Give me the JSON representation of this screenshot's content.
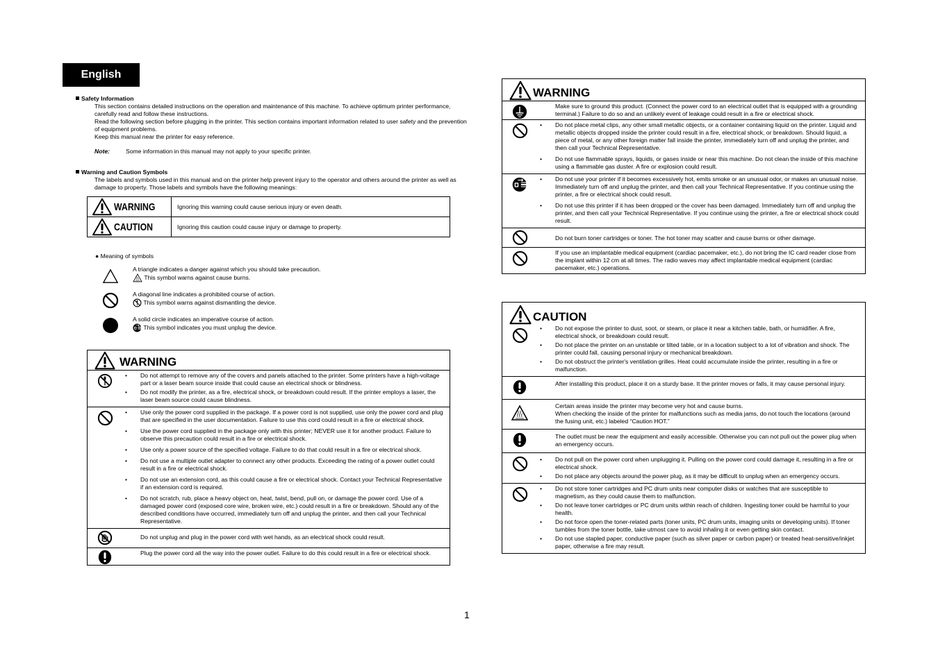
{
  "language_tab": "English",
  "safety": {
    "heading": "Safety Information",
    "paragraphs": [
      "This section contains detailed instructions on the operation and maintenance of this machine. To achieve optimum printer performance, carefully read and follow these instructions.",
      "Read the following section before plugging in the printer. This section contains important information related to user safety and the prevention of equipment problems.",
      "Keep this manual near the printer for easy reference."
    ],
    "note_label": "Note:",
    "note_text": "Some information in this manual may not apply to your specific printer."
  },
  "symbols": {
    "heading": "Warning and Caution Symbols",
    "intro": "The labels and symbols used in this manual and on the printer help prevent injury to the operator and others around the printer as well as damage to property. Those labels and symbols have the following meanings:",
    "legend": [
      {
        "icon": "warning-triangle-icon",
        "label": "WARNING",
        "text": "Ignoring this warning could cause serious injury or even death."
      },
      {
        "icon": "warning-triangle-icon",
        "label": "CAUTION",
        "text": "Ignoring this caution could cause injury or damage to property."
      }
    ],
    "meaning_heading": "Meaning of symbols",
    "meanings": [
      {
        "icon": "triangle-icon",
        "line1": "A triangle indicates a danger against which you should take precaution.",
        "example_icon": "hot-surface-icon",
        "line2": "This symbol warns against cause burns."
      },
      {
        "icon": "prohibited-icon",
        "line1": "A diagonal line indicates a prohibited course of action.",
        "example_icon": "no-disassembly-icon",
        "line2": "This symbol warns against dismantling the device."
      },
      {
        "icon": "solid-circle-icon",
        "line1": "A solid circle indicates an imperative course of action.",
        "example_icon": "unplug-icon",
        "line2": "This symbol indicates you must unplug the device."
      }
    ]
  },
  "warning_left": {
    "title": "WARNING",
    "rows": [
      {
        "icon": "no-disassembly-icon",
        "bullets": [
          "Do not attempt to remove any of the covers and panels attached to the printer. Some printers have a high-voltage part or a laser beam source inside that could cause an electrical shock or blindness.",
          "Do not modify the printer, as a fire, electrical shock, or breakdown could result. If the printer employs a laser, the laser beam source could cause blindness."
        ]
      },
      {
        "icon": "prohibited-icon",
        "bullets": [
          "Use only the power cord supplied in the package. If a power cord is not supplied, use only the power cord and plug that are specified in the user documentation. Failure to use this cord could result in a fire or electrical shock.",
          "Use the power cord supplied in the package only with this printer; NEVER use it for another product. Failure to observe this precaution could result in a fire or electrical shock.",
          "Use only a power source of the specified voltage. Failure to do that could result in a fire or electrical shock.",
          "Do not use a multiple outlet adapter to connect any other products. Exceeding the rating of a power outlet could result in a fire or electrical shock.",
          "Do not use an extension cord, as this could cause a fire or electrical shock. Contact your Technical Representative if an extension cord is required.",
          "Do not scratch, rub, place a heavy object on, heat, twist, bend, pull on, or damage the power cord. Use of a damaged power cord (exposed core wire, broken wire, etc.) could result in a fire or breakdown. Should any of the described conditions have occurred, immediately turn off and unplug the printer, and then call your Technical Representative."
        ]
      },
      {
        "icon": "no-wet-hands-icon",
        "text": "Do not unplug and plug in the power cord with wet hands, as an electrical shock could result."
      },
      {
        "icon": "exclamation-icon",
        "text": "Plug the power cord all the way into the power outlet. Failure to do this could result in a fire or electrical shock."
      }
    ]
  },
  "warning_right": {
    "title": "WARNING",
    "rows": [
      {
        "icon": "ground-icon",
        "text": "Make sure to ground this product. (Connect the power cord to an electrical outlet that is equipped with a grounding terminal.) Failure to do so and an unlikely event of leakage could result in a fire or electrical shock."
      },
      {
        "icon": "prohibited-icon",
        "bullets": [
          "Do not place metal clips, any other small metallic objects, or a container containing liquid on the printer. Liquid and metallic objects dropped inside the printer could result in a fire, electrical shock, or breakdown. Should liquid, a piece of metal, or any other foreign matter fall inside the printer, immediately turn off and unplug the printer, and then call your Technical Representative.",
          "Do not use flammable sprays, liquids, or gases inside or near this machine. Do not clean the inside of this machine using a flammable gas duster. A fire or explosion could result."
        ]
      },
      {
        "icon": "unplug-icon",
        "bullets": [
          "Do not use your printer if it becomes excessively hot, emits smoke or an unusual odor, or makes an unusual noise. Immediately turn off and unplug the printer, and then call your Technical Representative. If you continue using the printer, a fire or electrical shock could result.",
          "Do not use this printer if it has been dropped or the cover has been damaged. Immediately turn off and unplug the printer, and then call your Technical Representative. If you continue using the printer, a fire or electrical shock could result."
        ]
      },
      {
        "icon": "prohibited-icon",
        "text": "Do not burn toner cartridges or toner. The hot toner may scatter and cause burns or other damage."
      },
      {
        "icon": "prohibited-icon",
        "text": "If you use an implantable medical equipment (cardiac pacemaker, etc.), do not bring the IC card reader close from the implant within 12 cm at all times. The radio waves may affect implantable medical equipment (cardiac pacemaker, etc.) operations."
      }
    ]
  },
  "caution_right": {
    "title": "CAUTION",
    "rows": [
      {
        "icon": "prohibited-icon",
        "bullets": [
          "Do not expose the printer to dust, soot, or steam, or place it near a kitchen table, bath, or humidifier. A fire, electrical shock, or breakdown could result.",
          "Do not place the printer on an unstable or tilted table, or in a location subject to a lot of vibration and shock. The printer could fall, causing personal injury or mechanical breakdown.",
          "Do not obstruct the printer's ventilation grilles. Heat could accumulate inside the printer, resulting in a fire or malfunction."
        ]
      },
      {
        "icon": "exclamation-icon",
        "text": "After installing this product, place it on a sturdy base. It the printer moves or falls, it may cause personal injury."
      },
      {
        "icon": "hot-surface-icon",
        "text": "Certain areas inside the printer may become very hot and cause burns.\nWhen checking the inside of the printer for malfunctions such as media jams, do not touch the locations (around the fusing unit, etc.) labeled “Caution HOT.”"
      },
      {
        "icon": "exclamation-icon",
        "text": "The outlet must be near the equipment and easily accessible. Otherwise you can not pull out the power plug when an emergency occurs."
      },
      {
        "icon": "prohibited-icon",
        "bullets": [
          "Do not pull on the power cord when unplugging it. Pulling on the power cord could damage it, resulting in a fire or electrical shock.",
          "Do not place any objects around the power plug, as it may be difficult to unplug when an emergency occurs."
        ]
      },
      {
        "icon": "prohibited-icon",
        "bullets": [
          "Do not store toner cartridges and PC drum units near computer disks or watches that are susceptible to magnetism, as they could cause them to malfunction.",
          "Do not leave toner cartridges or PC drum units within reach of children. Ingesting toner could be harmful to your health.",
          "Do not force open the toner-related parts (toner units, PC drum units, imaging units or developing units). If toner tumbles from the toner bottle, take utmost care to avoid inhaling it or even getting skin contact.",
          "Do not use stapled paper, conductive paper (such as silver paper or carbon paper) or treated heat-sensitive/inkjet paper, otherwise a fire may result."
        ]
      }
    ]
  },
  "page_number": "1"
}
